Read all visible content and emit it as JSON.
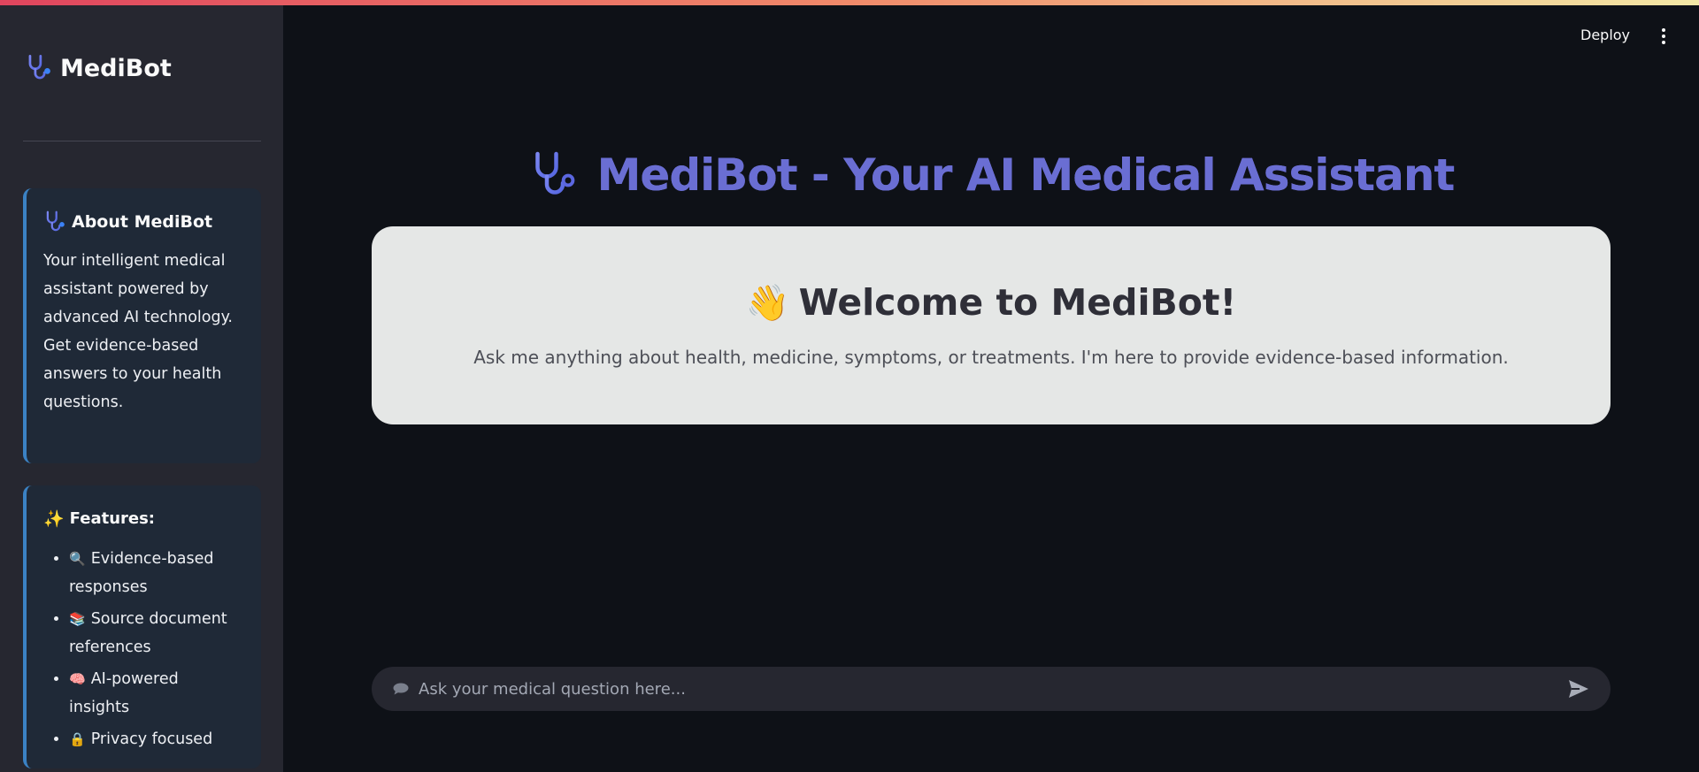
{
  "app": {
    "brand_name": "MediBot",
    "accent_color": "#6b78db",
    "card_border_color": "#3b82c4"
  },
  "header": {
    "deploy_label": "Deploy",
    "menu_icon": "kebab-menu-icon"
  },
  "sidebar": {
    "about": {
      "title": "About MediBot",
      "icon": "stethoscope-icon",
      "body": "Your intelligent medical assistant powered by advanced AI technology. Get evidence-based answers to your health questions."
    },
    "features": {
      "title": "Features:",
      "icon": "sparkles-icon",
      "items": [
        {
          "icon": "🔍",
          "label": "Evidence-based responses"
        },
        {
          "icon": "📚",
          "label": "Source document references"
        },
        {
          "icon": "🧠",
          "label": "AI-powered insights"
        },
        {
          "icon": "🔒",
          "label": "Privacy focused"
        }
      ]
    }
  },
  "main": {
    "title": "MediBot - Your AI Medical Assistant",
    "welcome": {
      "icon": "👋",
      "title": "Welcome to MediBot!",
      "subtitle": "Ask me anything about health, medicine, symptoms, or treatments. I'm here to provide evidence-based information."
    }
  },
  "chat": {
    "placeholder": "Ask your medical question here...",
    "value": ""
  }
}
